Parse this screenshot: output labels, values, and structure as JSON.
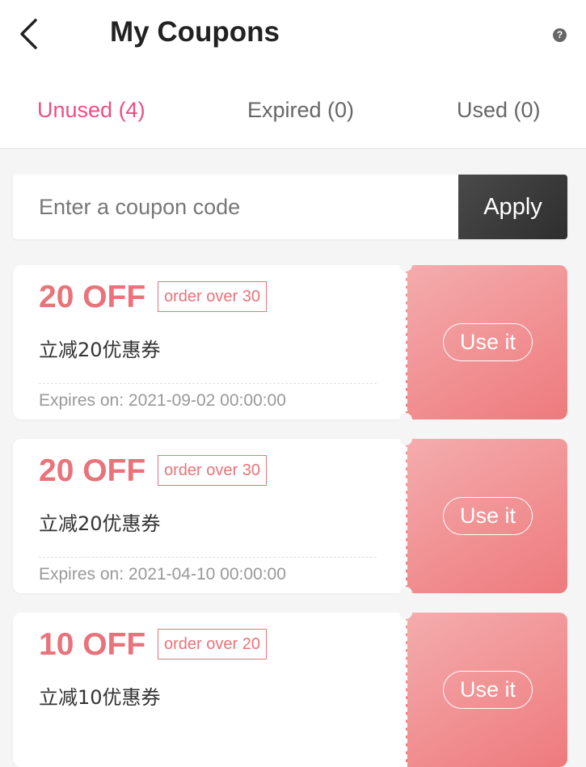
{
  "header": {
    "title": "My Coupons",
    "help_glyph": "?"
  },
  "tabs": [
    {
      "label": "Unused (4)",
      "active": true
    },
    {
      "label": "Expired (0)",
      "active": false
    },
    {
      "label": "Used (0)",
      "active": false
    }
  ],
  "coupon_code": {
    "placeholder": "Enter a coupon code",
    "value": "",
    "apply_label": "Apply"
  },
  "coupons": [
    {
      "amount": "20 OFF",
      "condition": "order over 30",
      "description": "立减20优惠券",
      "expires": "Expires on: 2021-09-02 00:00:00",
      "action_label": "Use it"
    },
    {
      "amount": "20 OFF",
      "condition": "order over 30",
      "description": "立减20优惠券",
      "expires": "Expires on: 2021-04-10 00:00:00",
      "action_label": "Use it"
    },
    {
      "amount": "10 OFF",
      "condition": "order over 20",
      "description": "立减10优惠券",
      "expires": "",
      "action_label": "Use it"
    }
  ],
  "colors": {
    "accent": "#ec4e82",
    "coupon_red": "#e9737a",
    "coupon_gradient_start": "#f4acad",
    "coupon_gradient_end": "#ee7a7d",
    "apply_button": "#3a3a3a"
  },
  "icons": {
    "back": "back-arrow-icon",
    "help": "help-circle-icon"
  }
}
